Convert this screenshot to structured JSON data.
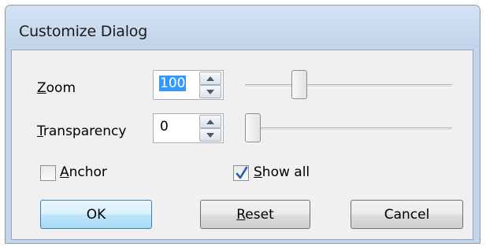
{
  "window": {
    "title": "Customize Dialog"
  },
  "zoom": {
    "label_mnemonic": "Z",
    "label_rest": "oom",
    "value": "100",
    "slider_level": 0.29
  },
  "transparency": {
    "label_mnemonic": "T",
    "label_rest": "ransparency",
    "value": "0",
    "slider_level": 0.0
  },
  "anchor": {
    "label_mnemonic": "A",
    "label_rest": "nchor",
    "checked": false
  },
  "show_all": {
    "label_mnemonic": "S",
    "label_rest": "how all",
    "checked": true
  },
  "buttons": {
    "ok": "OK",
    "reset_mnemonic": "R",
    "reset_rest": "eset",
    "cancel": "Cancel"
  },
  "colors": {
    "title_bar": "#c2d5ea",
    "selection": "#3399ff",
    "checkmark": "#2a5aa8",
    "default_button": "#bee6fd"
  },
  "icons": [
    "spin-up-icon",
    "spin-down-icon",
    "checkmark-icon"
  ]
}
